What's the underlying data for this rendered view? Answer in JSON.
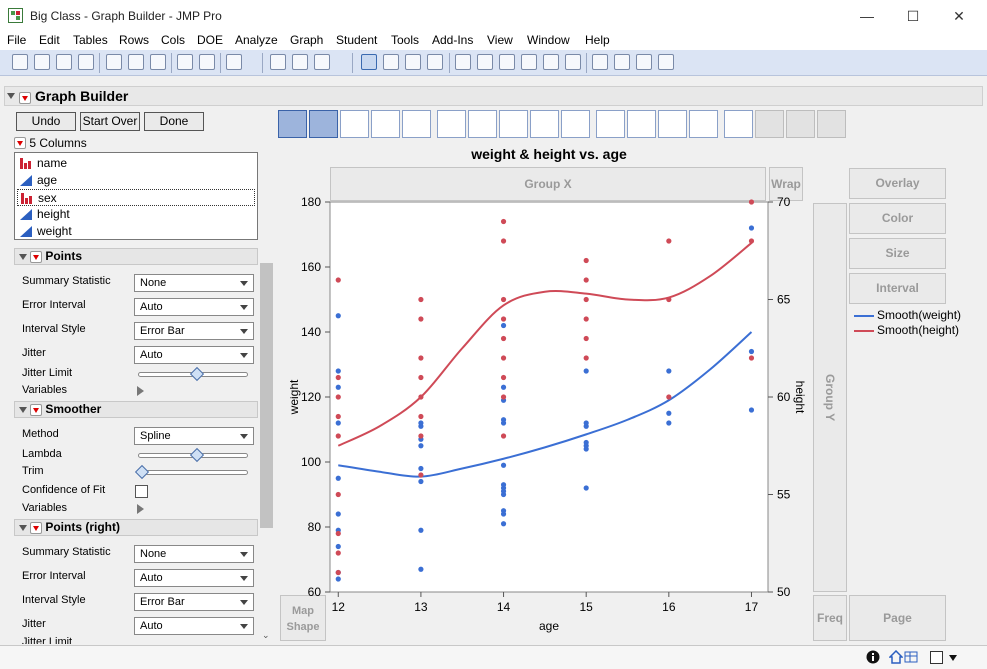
{
  "window": {
    "title": "Big Class - Graph Builder - JMP Pro",
    "minimize": "—",
    "maximize": "☐",
    "close": "✕"
  },
  "menu": [
    "File",
    "Edit",
    "Tables",
    "Rows",
    "Cols",
    "DOE",
    "Analyze",
    "Graph",
    "Student",
    "Tools",
    "Add-Ins",
    "View",
    "Window",
    "Help"
  ],
  "graph_builder": {
    "title": "Graph Builder",
    "buttons": {
      "undo": "Undo",
      "start_over": "Start Over",
      "done": "Done"
    },
    "columns_header": "5 Columns",
    "columns": [
      {
        "name": "name",
        "type": "nominal"
      },
      {
        "name": "age",
        "type": "continuous"
      },
      {
        "name": "sex",
        "type": "nominal"
      },
      {
        "name": "height",
        "type": "continuous"
      },
      {
        "name": "weight",
        "type": "continuous"
      }
    ],
    "selected_column": "sex",
    "points": {
      "title": "Points",
      "summary_statistic_label": "Summary Statistic",
      "summary_statistic": "None",
      "error_interval_label": "Error Interval",
      "error_interval": "Auto",
      "interval_style_label": "Interval Style",
      "interval_style": "Error Bar",
      "jitter_label": "Jitter",
      "jitter": "Auto",
      "jitter_limit_label": "Jitter Limit",
      "jitter_limit": 0.55,
      "variables_label": "Variables"
    },
    "smoother": {
      "title": "Smoother",
      "method_label": "Method",
      "method": "Spline",
      "lambda_label": "Lambda",
      "lambda": 0.55,
      "trim_label": "Trim",
      "trim": 0.0,
      "confidence_label": "Confidence of Fit",
      "confidence_checked": false,
      "variables_label": "Variables"
    },
    "points_right": {
      "title": "Points (right)",
      "summary_statistic_label": "Summary Statistic",
      "summary_statistic": "None",
      "error_interval_label": "Error Interval",
      "error_interval": "Auto",
      "interval_style_label": "Interval Style",
      "interval_style": "Error Bar",
      "jitter_label": "Jitter",
      "jitter": "Auto",
      "jitter_limit_label": "Jitter Limit"
    },
    "zones": {
      "group_x": "Group X",
      "wrap": "Wrap",
      "overlay": "Overlay",
      "color": "Color",
      "size": "Size",
      "interval": "Interval",
      "group_y": "Group Y",
      "freq": "Freq",
      "page": "Page",
      "map_shape": "Map Shape"
    }
  },
  "colors": {
    "weight": "#3b6fd4",
    "height": "#cf4a57",
    "accent": "#9db4dc"
  },
  "chart_data": {
    "type": "scatter",
    "title": "weight & height vs. age",
    "xlabel": "age",
    "ylabel": "weight",
    "y2label": "height",
    "xlim": [
      11.9,
      17.2
    ],
    "ylim": [
      60,
      180
    ],
    "y2lim": [
      50,
      70
    ],
    "x_ticks": [
      12,
      13,
      14,
      15,
      16,
      17
    ],
    "y_ticks": [
      60,
      80,
      100,
      120,
      140,
      160,
      180
    ],
    "y2_ticks": [
      50,
      55,
      60,
      65,
      70
    ],
    "legend_position": "right",
    "series": [
      {
        "name": "Smooth(weight)",
        "axis": "left",
        "color": "#3b6fd4",
        "points": [
          [
            12,
            64
          ],
          [
            12,
            66
          ],
          [
            12,
            74
          ],
          [
            12,
            79
          ],
          [
            12,
            84
          ],
          [
            12,
            95
          ],
          [
            12,
            112
          ],
          [
            12,
            123
          ],
          [
            12,
            128
          ],
          [
            12,
            145
          ],
          [
            13,
            67
          ],
          [
            13,
            79
          ],
          [
            13,
            94
          ],
          [
            13,
            98
          ],
          [
            13,
            105
          ],
          [
            13,
            107
          ],
          [
            13,
            111
          ],
          [
            13,
            112
          ],
          [
            14,
            81
          ],
          [
            14,
            84
          ],
          [
            14,
            85
          ],
          [
            14,
            90
          ],
          [
            14,
            91
          ],
          [
            14,
            92
          ],
          [
            14,
            93
          ],
          [
            14,
            99
          ],
          [
            14,
            112
          ],
          [
            14,
            113
          ],
          [
            14,
            119
          ],
          [
            14,
            123
          ],
          [
            14,
            142
          ],
          [
            15,
            92
          ],
          [
            15,
            104
          ],
          [
            15,
            105
          ],
          [
            15,
            106
          ],
          [
            15,
            111
          ],
          [
            15,
            112
          ],
          [
            15,
            128
          ],
          [
            16,
            112
          ],
          [
            16,
            115
          ],
          [
            16,
            128
          ],
          [
            17,
            116
          ],
          [
            17,
            134
          ],
          [
            17,
            172
          ]
        ],
        "smooth": [
          [
            12,
            99
          ],
          [
            12.5,
            97
          ],
          [
            13,
            95.5
          ],
          [
            13.5,
            98
          ],
          [
            14,
            101
          ],
          [
            14.5,
            104.5
          ],
          [
            15,
            108.5
          ],
          [
            15.5,
            113
          ],
          [
            16,
            119
          ],
          [
            16.5,
            128.5
          ],
          [
            17,
            140
          ]
        ]
      },
      {
        "name": "Smooth(height)",
        "axis": "right",
        "color": "#cf4a57",
        "points": [
          [
            12,
            51
          ],
          [
            12,
            52
          ],
          [
            12,
            53
          ],
          [
            12,
            55
          ],
          [
            12,
            58
          ],
          [
            12,
            59
          ],
          [
            12,
            60
          ],
          [
            12,
            61
          ],
          [
            12,
            66
          ],
          [
            13,
            56
          ],
          [
            13,
            58
          ],
          [
            13,
            59
          ],
          [
            13,
            60
          ],
          [
            13,
            61
          ],
          [
            13,
            62
          ],
          [
            13,
            64
          ],
          [
            13,
            65
          ],
          [
            14,
            58
          ],
          [
            14,
            60
          ],
          [
            14,
            61
          ],
          [
            14,
            62
          ],
          [
            14,
            63
          ],
          [
            14,
            64
          ],
          [
            14,
            65
          ],
          [
            14,
            68
          ],
          [
            14,
            69
          ],
          [
            15,
            62
          ],
          [
            15,
            63
          ],
          [
            15,
            64
          ],
          [
            15,
            65
          ],
          [
            15,
            66
          ],
          [
            15,
            67
          ],
          [
            16,
            60
          ],
          [
            16,
            65
          ],
          [
            16,
            68
          ],
          [
            17,
            62
          ],
          [
            17,
            68
          ],
          [
            17,
            70
          ]
        ],
        "smooth": [
          [
            12,
            57.5
          ],
          [
            12.5,
            58.5
          ],
          [
            13,
            60
          ],
          [
            13.5,
            62.5
          ],
          [
            14,
            64.7
          ],
          [
            14.5,
            65.4
          ],
          [
            15,
            65.3
          ],
          [
            15.5,
            65
          ],
          [
            16,
            65.1
          ],
          [
            16.5,
            66.2
          ],
          [
            17,
            67.9
          ]
        ]
      }
    ]
  }
}
